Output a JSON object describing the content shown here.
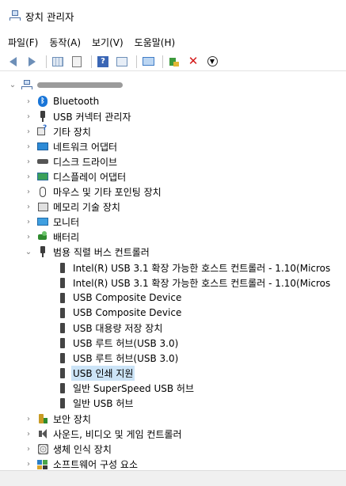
{
  "window": {
    "title": "장치 관리자"
  },
  "menu": [
    "파일(F)",
    "동작(A)",
    "보기(V)",
    "도움말(H)"
  ],
  "toolbar": {
    "buttons": [
      "back-icon",
      "forward-icon",
      "grid-icon",
      "properties-icon",
      "help-icon",
      "view-icon",
      "monitor-icon",
      "update-driver-icon",
      "uninstall-icon",
      "download-icon"
    ]
  },
  "tree": {
    "root": {
      "label": "",
      "expanded": true
    },
    "categories": [
      {
        "label": "Bluetooth",
        "icon": "bluetooth-icon",
        "expanded": false
      },
      {
        "label": "USB 커넥터 관리자",
        "icon": "usb-plug-icon",
        "expanded": false
      },
      {
        "label": "기타 장치",
        "icon": "other-devices-icon",
        "expanded": false
      },
      {
        "label": "네트워크 어댑터",
        "icon": "network-adapter-icon",
        "expanded": false
      },
      {
        "label": "디스크 드라이브",
        "icon": "disk-drive-icon",
        "expanded": false
      },
      {
        "label": "디스플레이 어댑터",
        "icon": "display-adapter-icon",
        "expanded": false
      },
      {
        "label": "마우스 및 기타 포인팅 장치",
        "icon": "mouse-icon",
        "expanded": false
      },
      {
        "label": "메모리 기술 장치",
        "icon": "memory-device-icon",
        "expanded": false
      },
      {
        "label": "모니터",
        "icon": "monitor-icon",
        "expanded": false
      },
      {
        "label": "배터리",
        "icon": "battery-icon",
        "expanded": false
      },
      {
        "label": "범용 직렬 버스 컨트롤러",
        "icon": "usb-plug-icon",
        "expanded": true
      }
    ],
    "usb_children": [
      {
        "label": "Intel(R) USB 3.1 확장 가능한 호스트 컨트롤러 - 1.10(Micros",
        "selected": false
      },
      {
        "label": "Intel(R) USB 3.1 확장 가능한 호스트 컨트롤러 - 1.10(Micros",
        "selected": false
      },
      {
        "label": "USB Composite Device",
        "selected": false
      },
      {
        "label": "USB Composite Device",
        "selected": false
      },
      {
        "label": "USB 대용량 저장 장치",
        "selected": false
      },
      {
        "label": "USB 루트 허브(USB 3.0)",
        "selected": false
      },
      {
        "label": "USB 루트 허브(USB 3.0)",
        "selected": false
      },
      {
        "label": "USB 인쇄 지원",
        "selected": true
      },
      {
        "label": "일반 SuperSpeed USB 허브",
        "selected": false
      },
      {
        "label": "일반 USB 허브",
        "selected": false
      }
    ],
    "after_categories": [
      {
        "label": "보안 장치",
        "icon": "security-device-icon",
        "expanded": false
      },
      {
        "label": "사운드, 비디오 및 게임 컨트롤러",
        "icon": "speaker-icon",
        "expanded": false
      },
      {
        "label": "생체 인식 장치",
        "icon": "biometric-icon",
        "expanded": false
      },
      {
        "label": "소프트웨어 구성 요소",
        "icon": "software-component-icon",
        "expanded": false
      }
    ]
  },
  "colors": {
    "selection": "#cce4f7",
    "accent": "#1875d8"
  }
}
